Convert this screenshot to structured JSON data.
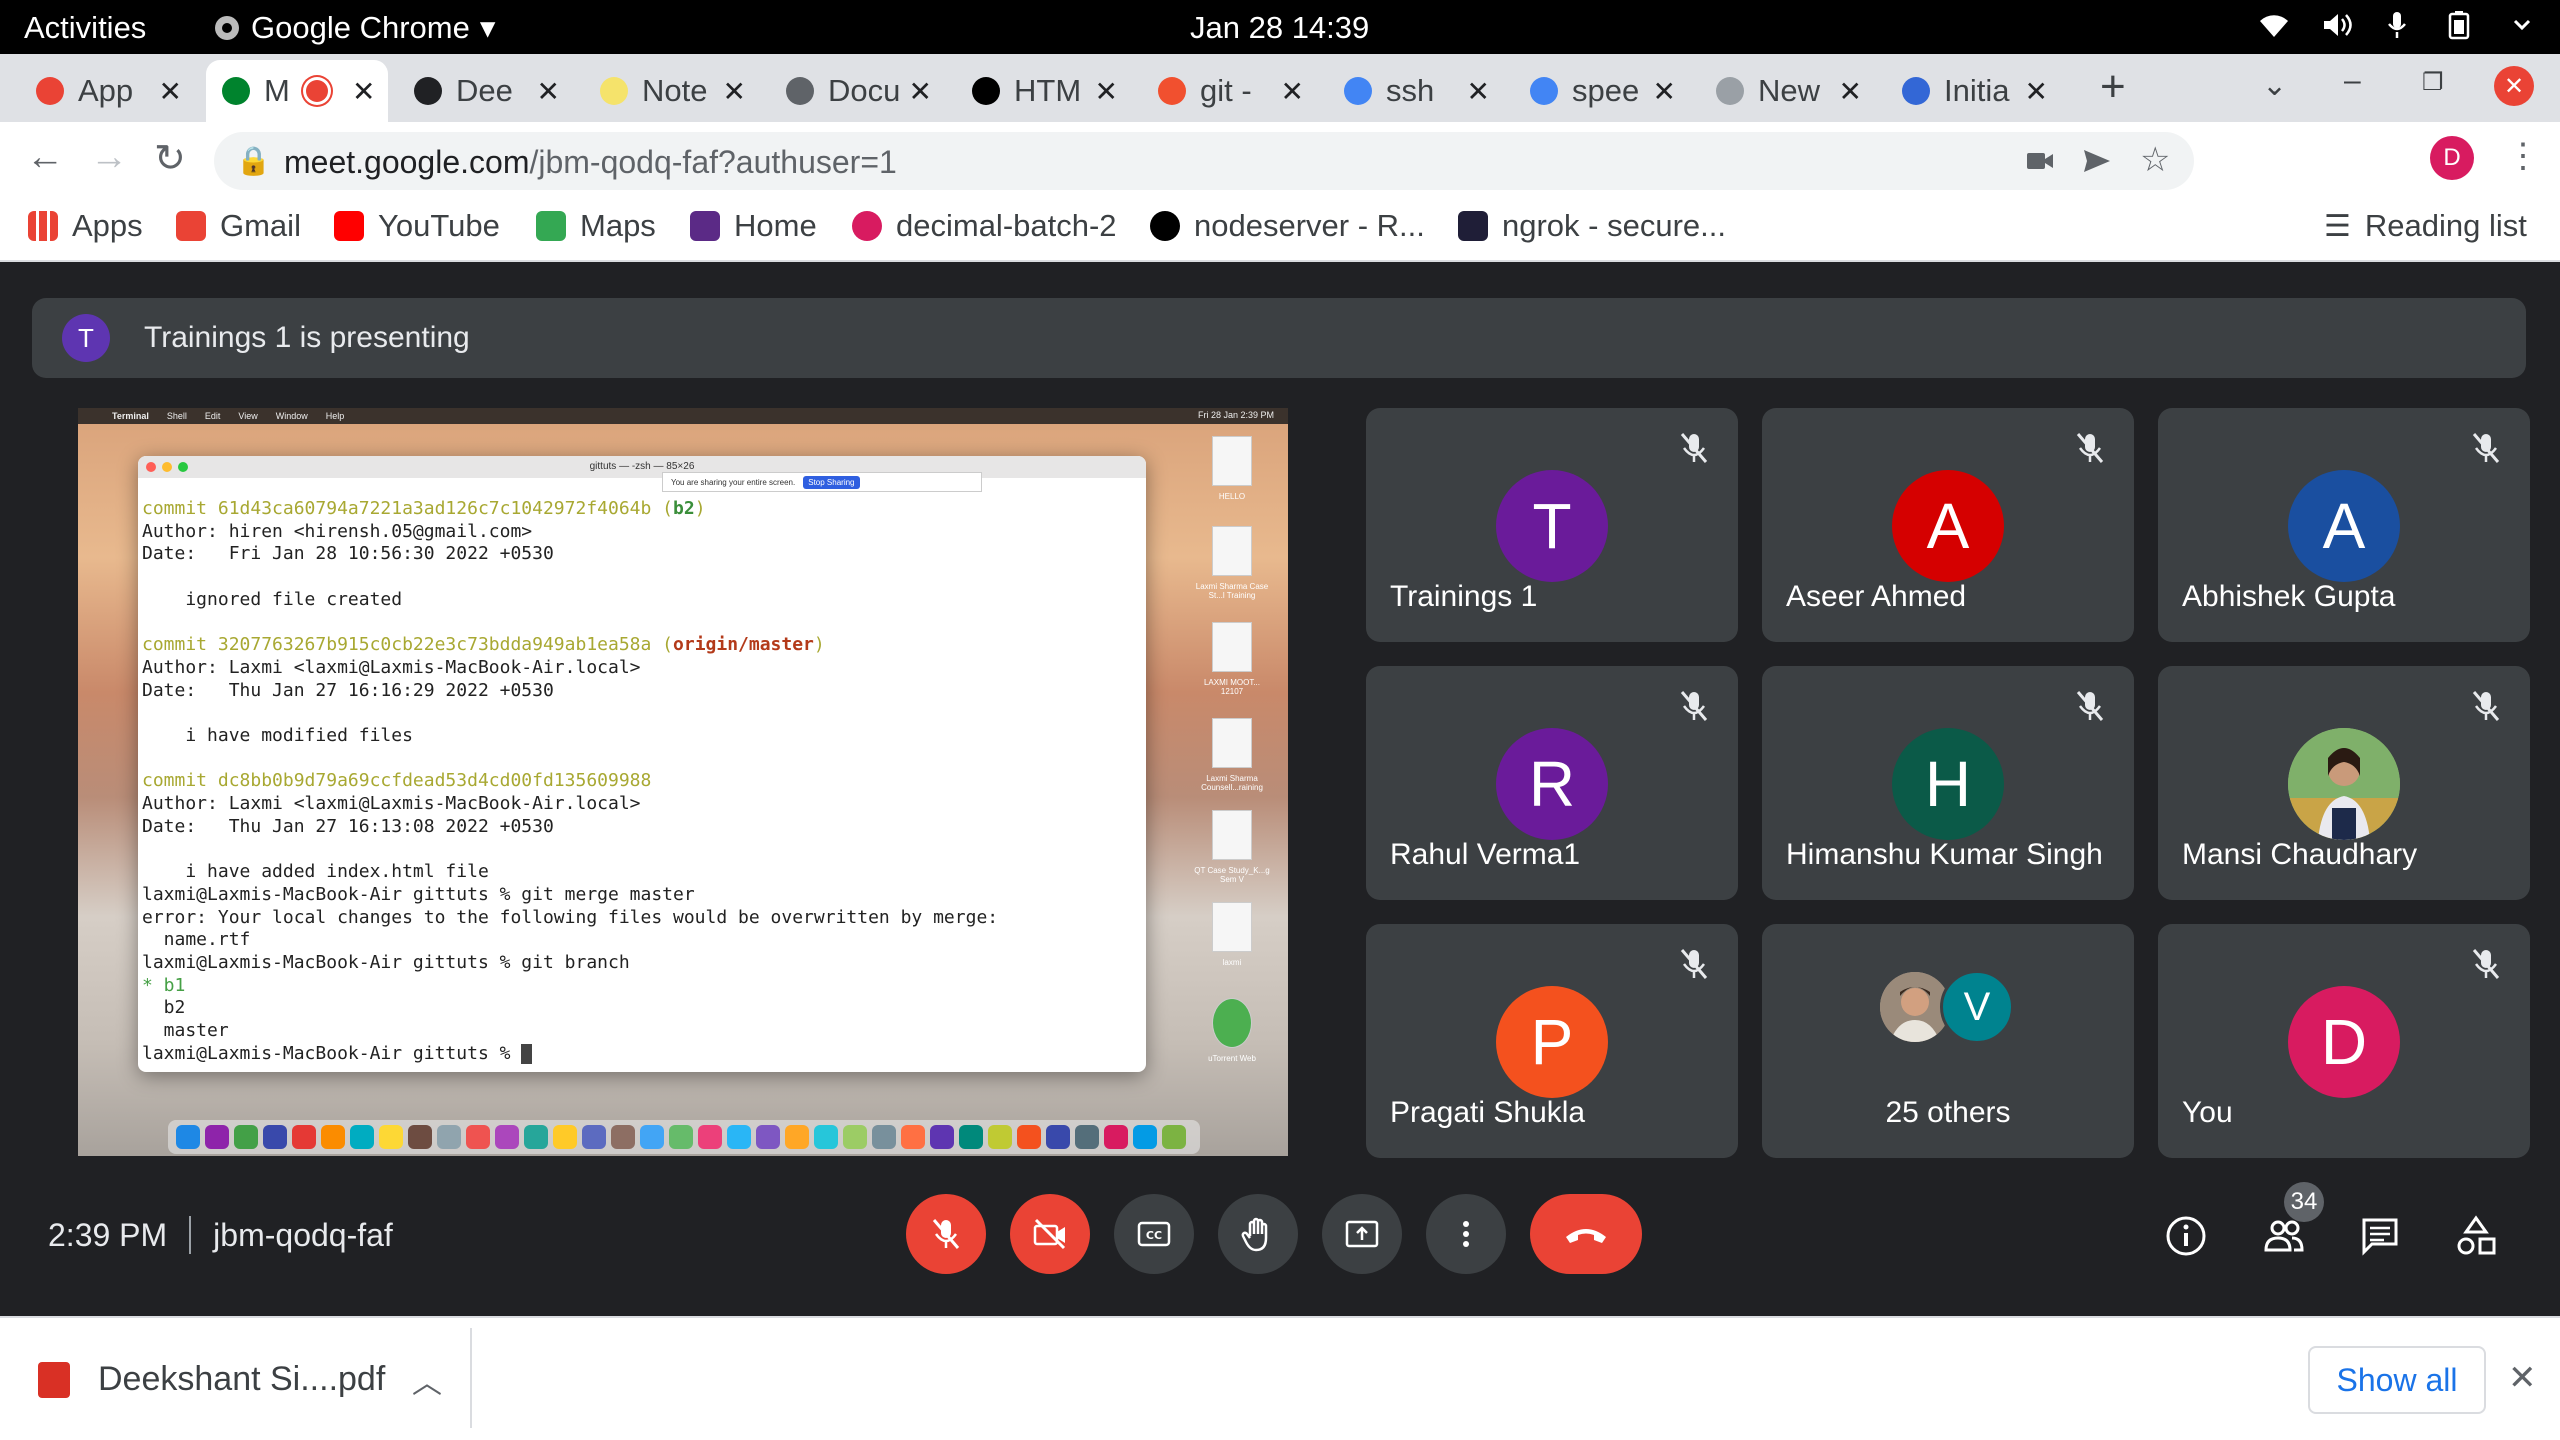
{
  "topbar": {
    "activities": "Activities",
    "app": "Google Chrome",
    "datetime": "Jan 28  14:39"
  },
  "tabs": [
    {
      "label": "App",
      "color": "#ea4335"
    },
    {
      "label": "M",
      "color": "#00832d"
    },
    {
      "label": "Dee",
      "color": "#202124"
    },
    {
      "label": "Note",
      "color": "#f5e36b"
    },
    {
      "label": "Docu",
      "color": "#5f6368"
    },
    {
      "label": "HTM",
      "color": "#000000"
    },
    {
      "label": "git -",
      "color": "#f1502f"
    },
    {
      "label": "ssh",
      "color": "#4285f4"
    },
    {
      "label": "spee",
      "color": "#4285f4"
    },
    {
      "label": "New",
      "color": "#9aa0a6"
    },
    {
      "label": "Initia",
      "color": "#3367d6"
    }
  ],
  "address": {
    "host": "meet.google.com",
    "path": "/jbm-qodq-faf?authuser=1"
  },
  "profile_initial": "D",
  "bookmarks": [
    {
      "label": "Apps",
      "color": "#ea4335"
    },
    {
      "label": "Gmail",
      "color": "#ea4335"
    },
    {
      "label": "YouTube",
      "color": "#ff0000"
    },
    {
      "label": "Maps",
      "color": "#34a853"
    },
    {
      "label": "Home",
      "color": "#5b2a86"
    },
    {
      "label": "decimal-batch-2",
      "color": "#d81b60"
    },
    {
      "label": "nodeserver - R...",
      "color": "#000000"
    },
    {
      "label": "ngrok - secure...",
      "color": "#1f1e37"
    }
  ],
  "reading_list": "Reading list",
  "presenting": {
    "initial": "T",
    "text": "Trainings 1 is presenting"
  },
  "shared_screen": {
    "menu": [
      "Terminal",
      "Shell",
      "Edit",
      "View",
      "Window",
      "Help"
    ],
    "clock": "Fri 28 Jan  2:39 PM",
    "window_title": "gittuts — -zsh — 85×26",
    "sharing_text": "You are sharing your entire screen.",
    "stop_sharing": "Stop Sharing",
    "lines": [
      {
        "parts": [
          {
            "t": "commit 61d43ca60794a7221a3ad126c7c1042972f4064b (",
            "c": "c-y"
          },
          {
            "t": "b2",
            "c": "c-gb"
          },
          {
            "t": ")",
            "c": "c-y"
          }
        ]
      },
      {
        "parts": [
          {
            "t": "Author: hiren <hirensh.05@gmail.com>",
            "c": ""
          }
        ]
      },
      {
        "parts": [
          {
            "t": "Date:   Fri Jan 28 10:56:30 2022 +0530",
            "c": ""
          }
        ]
      },
      {
        "parts": [
          {
            "t": "",
            "c": ""
          }
        ]
      },
      {
        "parts": [
          {
            "t": "    ignored file created",
            "c": ""
          }
        ]
      },
      {
        "parts": [
          {
            "t": "",
            "c": ""
          }
        ]
      },
      {
        "parts": [
          {
            "t": "commit 3207763267b915c0cb22e3c73bdda949ab1ea58a (",
            "c": "c-y"
          },
          {
            "t": "origin/master",
            "c": "c-r"
          },
          {
            "t": ")",
            "c": "c-y"
          }
        ]
      },
      {
        "parts": [
          {
            "t": "Author: Laxmi <laxmi@Laxmis-MacBook-Air.local>",
            "c": ""
          }
        ]
      },
      {
        "parts": [
          {
            "t": "Date:   Thu Jan 27 16:16:29 2022 +0530",
            "c": ""
          }
        ]
      },
      {
        "parts": [
          {
            "t": "",
            "c": ""
          }
        ]
      },
      {
        "parts": [
          {
            "t": "    i have modified files",
            "c": ""
          }
        ]
      },
      {
        "parts": [
          {
            "t": "",
            "c": ""
          }
        ]
      },
      {
        "parts": [
          {
            "t": "commit dc8bb0b9d79a69ccfdead53d4cd00fd135609988",
            "c": "c-y"
          }
        ]
      },
      {
        "parts": [
          {
            "t": "Author: Laxmi <laxmi@Laxmis-MacBook-Air.local>",
            "c": ""
          }
        ]
      },
      {
        "parts": [
          {
            "t": "Date:   Thu Jan 27 16:13:08 2022 +0530",
            "c": ""
          }
        ]
      },
      {
        "parts": [
          {
            "t": "",
            "c": ""
          }
        ]
      },
      {
        "parts": [
          {
            "t": "    i have added index.html file",
            "c": ""
          }
        ]
      },
      {
        "parts": [
          {
            "t": "laxmi@Laxmis-MacBook-Air gittuts % git merge master",
            "c": ""
          }
        ]
      },
      {
        "parts": [
          {
            "t": "error: Your local changes to the following files would be overwritten by merge:",
            "c": ""
          }
        ]
      },
      {
        "parts": [
          {
            "t": "  name.rtf",
            "c": ""
          }
        ]
      },
      {
        "parts": [
          {
            "t": "laxmi@Laxmis-MacBook-Air gittuts % git branch",
            "c": ""
          }
        ]
      },
      {
        "parts": [
          {
            "t": "* b1",
            "c": "c-g"
          }
        ]
      },
      {
        "parts": [
          {
            "t": "  b2",
            "c": ""
          }
        ]
      },
      {
        "parts": [
          {
            "t": "  master",
            "c": ""
          }
        ]
      },
      {
        "parts": [
          {
            "t": "laxmi@Laxmis-MacBook-Air gittuts % ",
            "c": ""
          }
        ]
      }
    ],
    "desktop_labels": [
      "HELLO",
      "Laxmi Sharma Case St...l Training",
      "LAXMI MOOT... 12107",
      "Laxmi Sharma Counsell...raining",
      "QT Case Study_K...g Sem V",
      "laxmi",
      "uTorrent Web"
    ],
    "dock_colors": [
      "#1e88e5",
      "#8e24aa",
      "#43a047",
      "#3949ab",
      "#e53935",
      "#fb8c00",
      "#00acc1",
      "#fdd835",
      "#6d4c41",
      "#90a4ae",
      "#ef5350",
      "#ab47bc",
      "#26a69a",
      "#ffca28",
      "#5c6bc0",
      "#8d6e63",
      "#42a5f5",
      "#66bb6a",
      "#ec407a",
      "#29b6f6",
      "#7e57c2",
      "#ffa726",
      "#26c6da",
      "#9ccc65",
      "#78909c",
      "#ff7043",
      "#5e35b1",
      "#00897b",
      "#c0ca33",
      "#f4511e",
      "#3949ab",
      "#546e7a",
      "#d81b60",
      "#039be5",
      "#7cb342"
    ]
  },
  "participants": [
    {
      "name": "Trainings 1",
      "initial": "T",
      "color": "#6a1b9a"
    },
    {
      "name": "Aseer Ahmed",
      "initial": "A",
      "color": "#d50000"
    },
    {
      "name": "Abhishek Gupta",
      "initial": "A",
      "color": "#1a4fa0"
    },
    {
      "name": "Rahul Verma1",
      "initial": "R",
      "color": "#6a1b9a"
    },
    {
      "name": "Himanshu Kumar Singh",
      "initial": "H",
      "color": "#0b5a48"
    },
    {
      "name": "Mansi Chaudhary",
      "initial": "",
      "color": "#8fb876"
    },
    {
      "name": "Pragati Shukla",
      "initial": "P",
      "color": "#f4511e"
    },
    {
      "name": "25 others",
      "initial": "V",
      "color": "#00838f"
    },
    {
      "name": "You",
      "initial": "D",
      "color": "#d81b60"
    }
  ],
  "meeting": {
    "time": "2:39 PM",
    "code": "jbm-qodq-faf",
    "people_count": "34"
  },
  "download": {
    "filename": "Deekshant Si....pdf",
    "show_all": "Show all"
  }
}
